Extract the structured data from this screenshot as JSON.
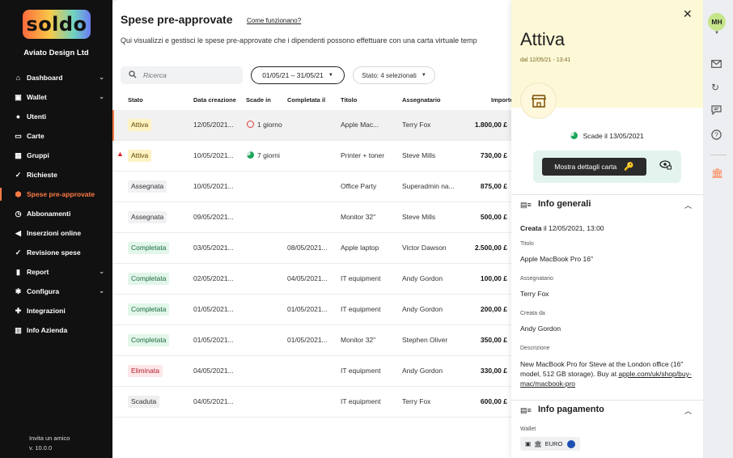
{
  "sidebar": {
    "logo": "soldo",
    "company": "Aviato Design Ltd",
    "items": [
      {
        "label": "Dashboard",
        "icon": "home-icon",
        "chevron": true
      },
      {
        "label": "Wallet",
        "icon": "wallet-icon",
        "chevron": true
      },
      {
        "label": "Utenti",
        "icon": "user-icon",
        "chevron": false
      },
      {
        "label": "Carte",
        "icon": "card-icon",
        "chevron": false
      },
      {
        "label": "Gruppi",
        "icon": "group-icon",
        "chevron": false
      },
      {
        "label": "Richieste",
        "icon": "check-icon",
        "chevron": false
      },
      {
        "label": "Spese pre-approvate",
        "icon": "shield-icon",
        "chevron": false,
        "active": true
      },
      {
        "label": "Abbonamenti",
        "icon": "clock-icon",
        "chevron": false
      },
      {
        "label": "Inserzioni online",
        "icon": "megaphone-icon",
        "chevron": false
      },
      {
        "label": "Revisione spese",
        "icon": "double-check-icon",
        "chevron": false
      },
      {
        "label": "Report",
        "icon": "bar-chart-icon",
        "chevron": true
      },
      {
        "label": "Configura",
        "icon": "gear-icon",
        "chevron": true
      },
      {
        "label": "Integrazioni",
        "icon": "puzzle-icon",
        "chevron": false
      },
      {
        "label": "Info Azienda",
        "icon": "building-icon",
        "chevron": false
      }
    ],
    "invite": "Invita un amico",
    "version": "v. 10.0.0"
  },
  "main": {
    "title": "Spese pre-approvate",
    "help_link": "Come funzionano?",
    "description": "Qui visualizzi e gestisci le spese pre-approvate che i dipendenti possono effettuare con una carta virtuale temp",
    "search_placeholder": "Ricerca",
    "date_filter": "01/05/21 – 31/05/21",
    "status_filter": "Stato: 4 selezionati",
    "columns": [
      "Stato",
      "Data creazione",
      "Scade in",
      "Completata il",
      "Titolo",
      "Assegnatario",
      "Importo"
    ],
    "rows": [
      {
        "status": "Attiva",
        "type": "active",
        "created": "12/05/2021...",
        "expires": "1 giorno",
        "exp_icon": "red",
        "completed": "",
        "title": "Apple Mac...",
        "assignee": "Terry Fox",
        "amount": "1.800,00 £",
        "selected": true
      },
      {
        "status": "Attiva",
        "type": "active",
        "created": "10/05/2021...",
        "expires": "7 giorni",
        "exp_icon": "green",
        "completed": "",
        "title": "Printer + toner",
        "assignee": "Steve Mills",
        "amount": "730,00 £",
        "warning": true
      },
      {
        "status": "Assegnata",
        "type": "assigned",
        "created": "10/05/2021...",
        "expires": "",
        "completed": "",
        "title": "Office Party",
        "assignee": "Superadmin na...",
        "amount": "875,00 £"
      },
      {
        "status": "Assegnata",
        "type": "assigned",
        "created": "09/05/2021...",
        "expires": "",
        "completed": "",
        "title": "Monitor 32\"",
        "assignee": "Steve Mills",
        "amount": "500,00 £"
      },
      {
        "status": "Completata",
        "type": "done",
        "created": "03/05/2021...",
        "expires": "",
        "completed": "08/05/2021...",
        "title": "Apple laptop",
        "assignee": "Victor Dawson",
        "amount": "2.500,00 £"
      },
      {
        "status": "Completata",
        "type": "done",
        "created": "02/05/2021...",
        "expires": "",
        "completed": "04/05/2021...",
        "title": "IT equipment",
        "assignee": "Andy Gordon",
        "amount": "100,00 £"
      },
      {
        "status": "Completata",
        "type": "done",
        "created": "01/05/2021...",
        "expires": "",
        "completed": "01/05/2021...",
        "title": "IT equipment",
        "assignee": "Andy Gordon",
        "amount": "200,00 £"
      },
      {
        "status": "Completata",
        "type": "done",
        "created": "01/05/2021...",
        "expires": "",
        "completed": "01/05/2021...",
        "title": "Monitor 32\"",
        "assignee": "Stephen Oliver",
        "amount": "350,00 £"
      },
      {
        "status": "Eliminata",
        "type": "deleted",
        "created": "04/05/2021...",
        "expires": "",
        "completed": "",
        "title": "IT equipment",
        "assignee": "Andy Gordon",
        "amount": "330,00 £"
      },
      {
        "status": "Scaduta",
        "type": "expired",
        "created": "04/05/2021...",
        "expires": "",
        "completed": "",
        "title": "IT equipment",
        "assignee": "Terry Fox",
        "amount": "600,00 £"
      }
    ]
  },
  "panel": {
    "status": "Attiva",
    "since": "dal 12/05/21 - 13:41",
    "expiry": "Scade il 13/05/2021",
    "show_card_button": "Mostra dettagli carta",
    "general_section": "Info generali",
    "created_label": "Creata",
    "created_value": "il 12/05/2021, 13:00",
    "title_label": "Titolo",
    "title_value": "Apple MacBook Pro 16\"",
    "assignee_label": "Assegnatario",
    "assignee_value": "Terry Fox",
    "creator_label": "Creata da",
    "creator_value": "Andy Gordon",
    "description_label": "Descrizione",
    "description_text": "New MacBook Pro for Steve at the London office (16\" model, 512 GB storage). Buy at ",
    "description_link": "apple.com/uk/shop/buy-mac/macbook-pro",
    "payment_section": "Info pagamento",
    "wallet_label": "Wallet",
    "wallet_value": "EURO"
  },
  "rail": {
    "avatar": "MH"
  },
  "colors": {
    "accent": "#ff7a45",
    "sidebar_bg": "#111111",
    "panel_header_bg": "#fdf8d6"
  }
}
